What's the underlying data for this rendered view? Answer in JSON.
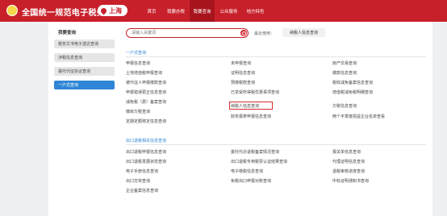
{
  "header": {
    "site_title": "全国统一规范电子税务局",
    "region": "上海",
    "nav": [
      "首页",
      "我要办税",
      "我要查询",
      "公众服务",
      "地方特色"
    ]
  },
  "sidebar": {
    "title": "我要查询",
    "items": [
      "税务文书电子送达查询",
      "涉税信息查询",
      "委托代征协议查询",
      "一户式查询"
    ]
  },
  "search": {
    "placeholder": "请输入关键词",
    "recent_label": "最近使用：",
    "recent_item": "纳税人信息查询"
  },
  "sections": [
    {
      "title": "一户式查询",
      "col1": [
        "申报信息查询",
        "土地增值税申报查询",
        "被代征人申报缴款查询",
        "申报错误更正信息查询",
        "减免税（费）备案查询",
        "缴库欠税查询",
        "定期定额核定信息查询"
      ],
      "col2": [
        "未申报查询",
        "证明信息查询",
        "预缴税款查询",
        "已享受所得税优惠事项查询",
        "纳税人信息查询",
        "财务报表申报信息查询"
      ],
      "col3": [
        "房产交易查询",
        "缴款信息查询",
        "税收减免备案信息查询",
        "增值税减免税明细查询",
        "欠税信息查询",
        "两个平季度损益企业名单查看"
      ]
    },
    {
      "title": "出口退税相关信息查询",
      "col1": [
        "出口退税申报信息查询",
        "出口退税发展状态查询",
        "电子手册信息查询",
        "出口交单查询",
        "企业备案信息查询"
      ],
      "col2": [
        "委托代办退税备案情况查询",
        "出口退税专用税票认证结果查询",
        "电子缴税信息查询",
        "免税出口申报对账查询"
      ],
      "col3": [
        "报关单信息查询",
        "代理证明信息查询",
        "退税审核进度查询",
        "中标证明通知书查询"
      ]
    }
  ]
}
